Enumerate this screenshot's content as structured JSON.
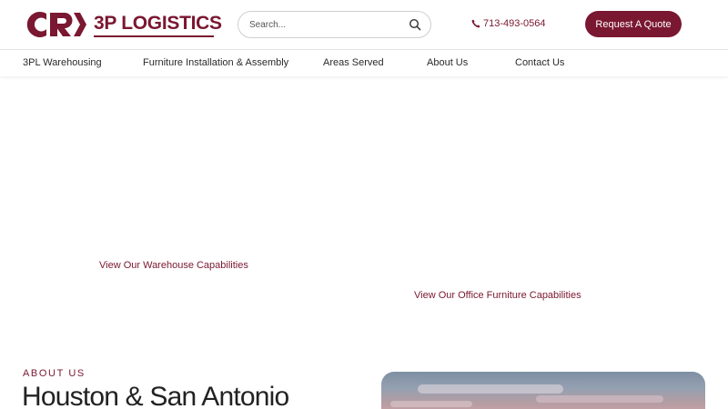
{
  "brand": {
    "logo_mark": "CR",
    "name": "3P LOGISTICS",
    "color": "#7a1731"
  },
  "search": {
    "placeholder": "Search...",
    "icon": "search-icon"
  },
  "contact": {
    "phone": "713-493-0564",
    "icon": "phone-icon"
  },
  "cta": {
    "label": "Request A Quote"
  },
  "nav": {
    "items": [
      {
        "label": "3PL Warehousing"
      },
      {
        "label": "Furniture Installation & Assembly"
      },
      {
        "label": "Areas Served"
      },
      {
        "label": "About Us"
      },
      {
        "label": "Contact Us"
      }
    ]
  },
  "capabilities": {
    "warehouse_link": "View Our Warehouse Capabilities",
    "office_link": "View Our Office Furniture Capabilities"
  },
  "about": {
    "eyebrow": "ABOUT US",
    "heading": "Houston & San Antonio"
  }
}
